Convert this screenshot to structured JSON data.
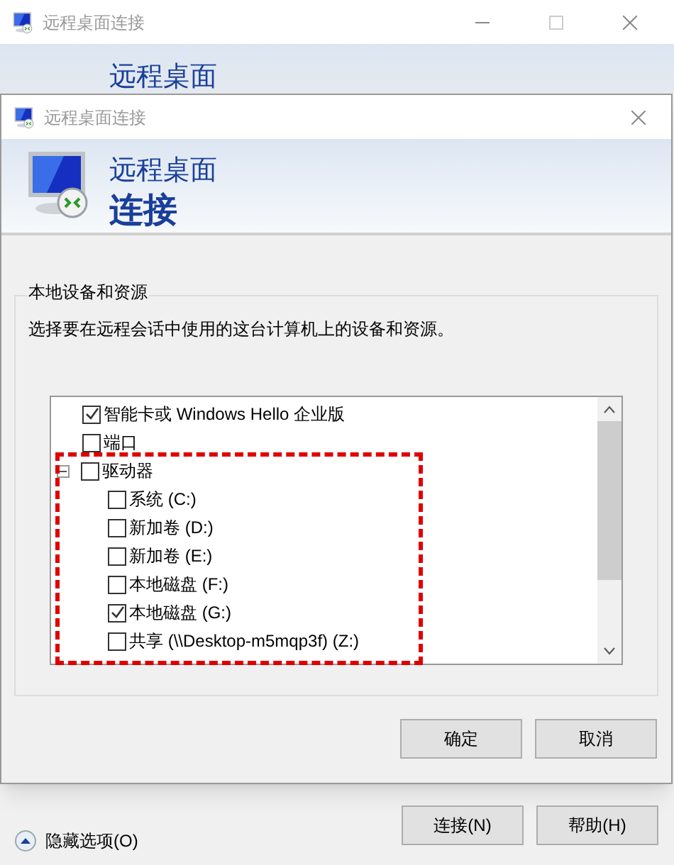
{
  "back_window": {
    "title": "远程桌面连接",
    "banner": "远程桌面",
    "toggle": "隐藏选项(O)",
    "buttons": [
      "连接(N)",
      "帮助(H)"
    ]
  },
  "dialog": {
    "title": "远程桌面连接",
    "banner_line1": "远程桌面",
    "banner_line2": "连接",
    "group_title": "本地设备和资源",
    "description": "选择要在远程会话中使用的这台计算机上的设备和资源。",
    "devices": [
      {
        "label": "智能卡或 Windows Hello 企业版",
        "checked": true
      },
      {
        "label": "端口",
        "checked": false
      },
      {
        "label": "驱动器",
        "checked": false,
        "expanded": true,
        "children": [
          {
            "label": "系统 (C:)",
            "checked": false
          },
          {
            "label": "新加卷 (D:)",
            "checked": false
          },
          {
            "label": "新加卷 (E:)",
            "checked": false
          },
          {
            "label": "本地磁盘 (F:)",
            "checked": false
          },
          {
            "label": "本地磁盘 (G:)",
            "checked": true
          },
          {
            "label": "共享 (\\\\Desktop-m5mqp3f) (Z:)",
            "checked": false
          }
        ]
      }
    ],
    "buttons": [
      "确定",
      "取消"
    ]
  }
}
